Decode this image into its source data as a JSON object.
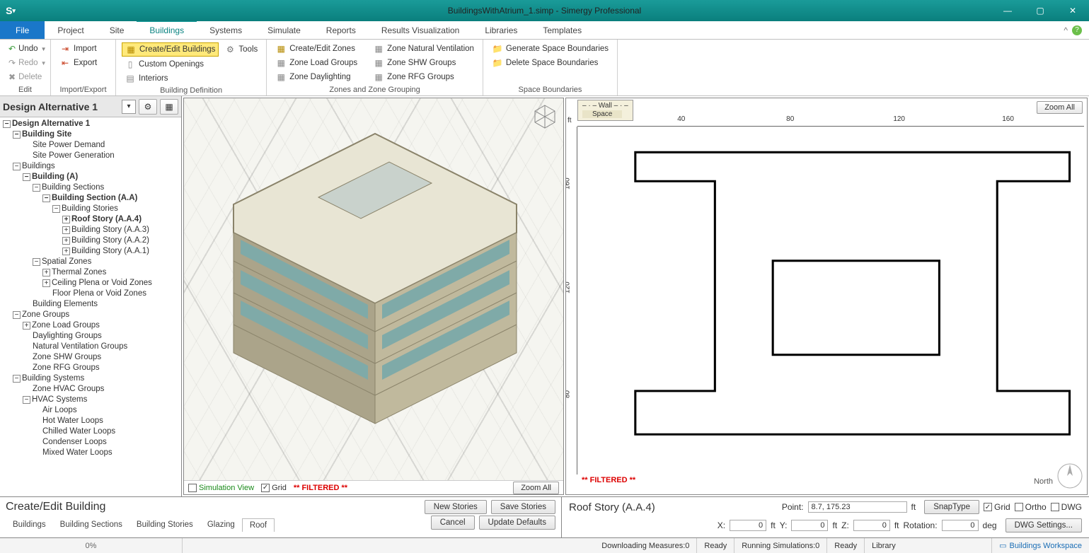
{
  "title": "BuildingsWithAtrium_1.simp - Simergy Professional",
  "menu": {
    "file": "File",
    "project": "Project",
    "site": "Site",
    "buildings": "Buildings",
    "systems": "Systems",
    "simulate": "Simulate",
    "reports": "Reports",
    "results": "Results Visualization",
    "libraries": "Libraries",
    "templates": "Templates"
  },
  "ribbon": {
    "edit": {
      "undo": "Undo",
      "redo": "Redo",
      "delete": "Delete",
      "group": "Edit"
    },
    "impexp": {
      "import": "Import",
      "export": "Export",
      "group": "Import/Export"
    },
    "bdef": {
      "createedit": "Create/Edit Buildings",
      "tools": "Tools",
      "custom": "Custom Openings",
      "interiors": "Interiors",
      "group": "Building Definition"
    },
    "zones": {
      "czones": "Create/Edit Zones",
      "load": "Zone Load Groups",
      "day": "Zone Daylighting",
      "natv": "Zone Natural Ventilation",
      "shw": "Zone SHW Groups",
      "rfg": "Zone RFG Groups",
      "group": "Zones and Zone Grouping"
    },
    "spaceb": {
      "gen": "Generate Space Boundaries",
      "del": "Delete Space Boundaries",
      "group": "Space Boundaries"
    }
  },
  "designBar": {
    "title": "Design Alternative 1"
  },
  "tree": {
    "root": "Design Alternative 1",
    "site": "Building Site",
    "sitePower": "Site Power Demand",
    "siteGen": "Site Power Generation",
    "buildings": "Buildings",
    "buildingA": "Building (A)",
    "sections": "Building Sections",
    "sectionAA": "Building Section (A.A)",
    "stories": "Building Stories",
    "roof": "Roof Story (A.A.4)",
    "s3": "Building Story (A.A.3)",
    "s2": "Building Story (A.A.2)",
    "s1": "Building Story (A.A.1)",
    "spatial": "Spatial Zones",
    "thermal": "Thermal Zones",
    "ceilPlena": "Ceiling Plena or Void Zones",
    "floorPlena": "Floor Plena or Void Zones",
    "belem": "Building Elements",
    "zgroups": "Zone Groups",
    "zload": "Zone Load Groups",
    "dayg": "Daylighting Groups",
    "natv": "Natural Ventilation Groups",
    "shw": "Zone SHW Groups",
    "rfg": "Zone RFG Groups",
    "bsys": "Building Systems",
    "hvacg": "Zone HVAC Groups",
    "hvacs": "HVAC Systems",
    "air": "Air Loops",
    "hot": "Hot Water Loops",
    "chilled": "Chilled Water Loops",
    "cond": "Condenser Loops",
    "mixed": "Mixed Water Loops"
  },
  "view3d": {
    "simview": "Simulation View",
    "grid": "Grid",
    "filtered": "** FILTERED **",
    "zoomall": "Zoom All"
  },
  "view2d": {
    "legendWall": "Wall",
    "legendSpace": "Space",
    "unit": "ft",
    "ticksH": [
      "40",
      "80",
      "120",
      "160"
    ],
    "ticksV": [
      "80",
      "120",
      "160"
    ],
    "filtered": "** FILTERED **",
    "north": "North",
    "zoomall": "Zoom All"
  },
  "bottomLeft": {
    "title": "Create/Edit Building",
    "newS": "New Stories",
    "saveS": "Save Stories",
    "cancel": "Cancel",
    "upd": "Update Defaults",
    "tabs": {
      "buildings": "Buildings",
      "sections": "Building Sections",
      "stories": "Building Stories",
      "glazing": "Glazing",
      "roof": "Roof"
    }
  },
  "bottomRight": {
    "title": "Roof Story (A.A.4)",
    "pointLabel": "Point:",
    "pointVal": "8.7, 175.23",
    "pointUnit": "ft",
    "snap": "SnapType",
    "grid": "Grid",
    "ortho": "Ortho",
    "dwg": "DWG",
    "xl": "X:",
    "xval": "0",
    "xu": "ft",
    "yl": "Y:",
    "yval": "0",
    "yu": "ft",
    "zl": "Z:",
    "zval": "0",
    "zu": "ft",
    "rotl": "Rotation:",
    "rotval": "0",
    "rotu": "deg",
    "dwgset": "DWG Settings..."
  },
  "status": {
    "pct": "0%",
    "dl": "Downloading Measures:0",
    "ready1": "Ready",
    "run": "Running Simulations:0",
    "ready2": "Ready",
    "lib": "Library",
    "ws": "Buildings Workspace"
  }
}
